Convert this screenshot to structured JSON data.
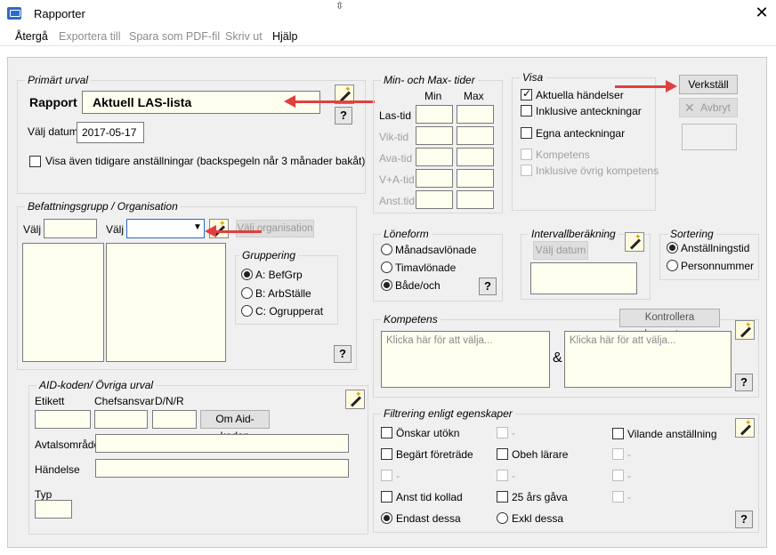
{
  "window": {
    "title": "Rapporter"
  },
  "menu": [
    "Återgå",
    "Exportera till",
    "Spara som PDF-fil",
    "Skriv ut",
    "Hjälp"
  ],
  "primary": {
    "title": "Primärt urval",
    "rapport_label": "Rapport",
    "rapport_value": "Aktuell LAS-lista",
    "date_label": "Välj datum",
    "date_value": "2017-05-17",
    "history_checkbox": "Visa även tidigare anställningar (backspegeln når 3 månader bakåt)"
  },
  "minmax": {
    "title": "Min- och Max- tider",
    "min": "Min",
    "max": "Max",
    "rows": [
      "Las-tid",
      "Vik-tid",
      "Ava-tid",
      "V+A-tid",
      "Anst.tid"
    ]
  },
  "visa": {
    "title": "Visa",
    "items": [
      "Aktuella händelser",
      "Inklusive anteckningar",
      "Egna anteckningar",
      "Kompetens",
      "Inklusive övrig kompetens"
    ]
  },
  "actions": {
    "apply": "Verkställ",
    "cancel": "Avbryt"
  },
  "befattning": {
    "title": "Befattningsgrupp / Organisation",
    "valj1": "Välj",
    "valj2": "Välj",
    "org_button": "Välj organisation",
    "grouping_title": "Gruppering",
    "grouping": [
      "A: BefGrp",
      "B: ArbStälle",
      "C: Ogrupperat"
    ],
    "help": "?"
  },
  "aid": {
    "title": "AID-koden/ Övriga urval",
    "etikett": "Etikett",
    "chefsansvar": "Chefsansvar",
    "dnr": "D/N/R",
    "aid_button": "Om Aid-koden",
    "avtalsomrade": "Avtalsområde",
    "handelse": "Händelse",
    "typ": "Typ"
  },
  "loneform": {
    "title": "Löneform",
    "options": [
      "Månadsavlönade",
      "Timavlönade",
      "Både/och"
    ],
    "help": "?"
  },
  "intervall": {
    "title": "Intervallberäkning",
    "button": "Välj datum"
  },
  "sortering": {
    "title": "Sortering",
    "options": [
      "Anställningstid",
      "Personnummer"
    ]
  },
  "kompetens": {
    "title": "Kompetens",
    "check_button": "Kontrollera kompetens",
    "placeholder1": "Klicka här för att välja...",
    "placeholder2": "Klicka här för att välja...",
    "amp": "&",
    "help": "?"
  },
  "filtrering": {
    "title": "Filtrering enligt egenskaper",
    "col1": [
      "Önskar utökn",
      "Begärt företräde",
      "-",
      "Anst tid kollad"
    ],
    "col2": [
      "-",
      "Obeh lärare",
      "-",
      "25 års gåva"
    ],
    "col3": [
      "Vilande anställning",
      "-",
      "-",
      "-"
    ],
    "radio1": "Endast dessa",
    "radio2": "Exkl dessa",
    "help": "?"
  }
}
